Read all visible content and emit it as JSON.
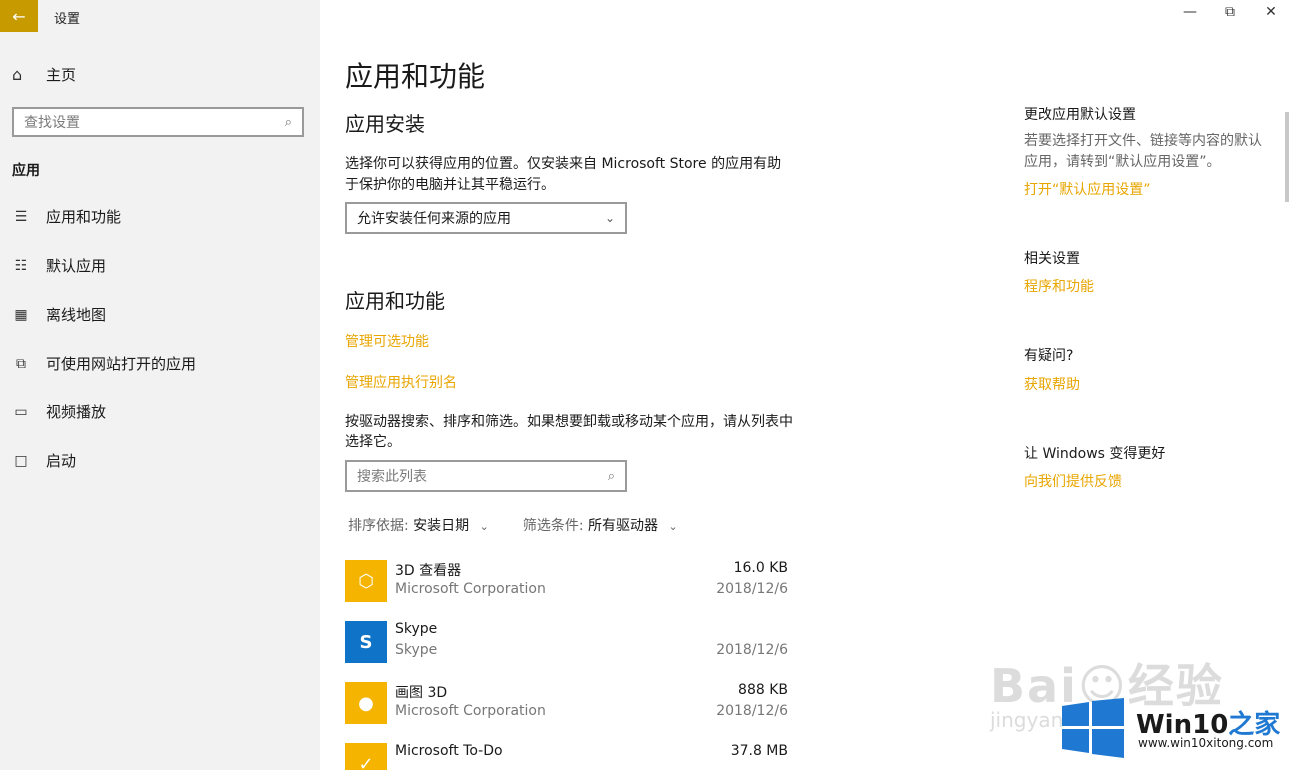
{
  "window": {
    "back_icon": "←",
    "title": "设置",
    "minimize": "—",
    "maximize": "⧉",
    "close": "✕"
  },
  "sidebar": {
    "home_icon": "⌂",
    "home_label": "主页",
    "search_placeholder": "查找设置",
    "search_icon": "⌕",
    "section": "应用",
    "items": [
      {
        "icon": "☰",
        "label": "应用和功能"
      },
      {
        "icon": "☷",
        "label": "默认应用"
      },
      {
        "icon": "▦",
        "label": "离线地图"
      },
      {
        "icon": "⧉",
        "label": "可使用网站打开的应用"
      },
      {
        "icon": "▭",
        "label": "视频播放"
      },
      {
        "icon": "□",
        "label": "启动"
      }
    ]
  },
  "main": {
    "title": "应用和功能",
    "install_heading": "应用安装",
    "install_desc": "选择你可以获得应用的位置。仅安装来自 Microsoft Store 的应用有助于保护你的电脑并让其平稳运行。",
    "install_option": "允许安装任何来源的应用",
    "features_heading": "应用和功能",
    "manage_optional": "管理可选功能",
    "manage_alias": "管理应用执行别名",
    "list_desc": "按驱动器搜索、排序和筛选。如果想要卸载或移动某个应用，请从列表中选择它。",
    "list_search_placeholder": "搜索此列表",
    "sort_label": "排序依据:",
    "sort_value": "安装日期",
    "filter_label": "筛选条件:",
    "filter_value": "所有驱动器",
    "apps": [
      {
        "name": "3D 查看器",
        "publisher": "Microsoft Corporation",
        "size": "16.0 KB",
        "date": "2018/12/6",
        "color": "#f4b400",
        "glyph": "⬡"
      },
      {
        "name": "Skype",
        "publisher": "Skype",
        "size": "",
        "date": "2018/12/6",
        "color": "#0f74c8",
        "glyph": "S"
      },
      {
        "name": "画图 3D",
        "publisher": "Microsoft Corporation",
        "size": "888 KB",
        "date": "2018/12/6",
        "color": "#f4b400",
        "glyph": "●"
      },
      {
        "name": "Microsoft To-Do",
        "publisher": "",
        "size": "37.8 MB",
        "date": "",
        "color": "#f4b400",
        "glyph": "✓"
      }
    ]
  },
  "right": {
    "default_heading": "更改应用默认设置",
    "default_desc": "若要选择打开文件、链接等内容的默认应用，请转到“默认应用设置”。",
    "default_link": "打开“默认应用设置”",
    "related_heading": "相关设置",
    "related_link": "程序和功能",
    "help_heading": "有疑问?",
    "help_link": "获取帮助",
    "feedback_heading": "让 Windows 变得更好",
    "feedback_link": "向我们提供反馈"
  },
  "watermark": {
    "baidu": "Bai☺经验",
    "baidu_sub": "jingyan",
    "win_title_a": "Win10",
    "win_title_b": "之家",
    "win_url": "www.win10xitong.com"
  },
  "colors": {
    "accent": "#e8a600",
    "titlebar_accent": "#c79a00",
    "sidebar_bg": "#f2f2f2"
  }
}
